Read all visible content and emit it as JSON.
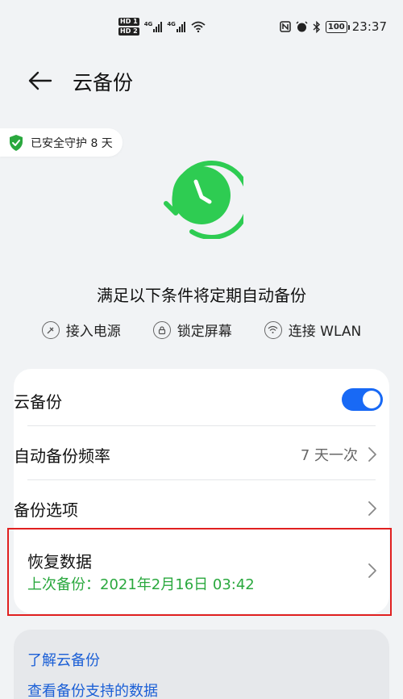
{
  "status_bar": {
    "hd1": "HD 1",
    "hd2": "HD 2",
    "net1": "4G",
    "net2": "4G",
    "battery": "100",
    "time": "23:37"
  },
  "header": {
    "back_icon": "arrow-left-icon",
    "title": "云备份"
  },
  "protect_badge": {
    "icon": "shield-check-icon",
    "text": "已安全守护 8 天",
    "color": "#2aa83e"
  },
  "illustration": {
    "icon": "clock-refresh-icon",
    "color": "#2ecc52"
  },
  "conditions": {
    "title": "满足以下条件将定期自动备份",
    "items": [
      {
        "icon": "power-plug-icon",
        "label": "接入电源"
      },
      {
        "icon": "lock-icon",
        "label": "锁定屏幕"
      },
      {
        "icon": "wifi-icon",
        "label": "连接 WLAN"
      }
    ]
  },
  "settings": {
    "cloud_backup": {
      "label": "云备份",
      "enabled": true,
      "accent": "#1869f5"
    },
    "frequency": {
      "label": "自动备份频率",
      "value": "7 天一次"
    },
    "options": {
      "label": "备份选项"
    },
    "restore": {
      "label": "恢复数据",
      "last_backup": "上次备份：2021年2月16日 03:42"
    }
  },
  "links": {
    "learn": "了解云备份",
    "supported": "查看备份支持的数据"
  }
}
